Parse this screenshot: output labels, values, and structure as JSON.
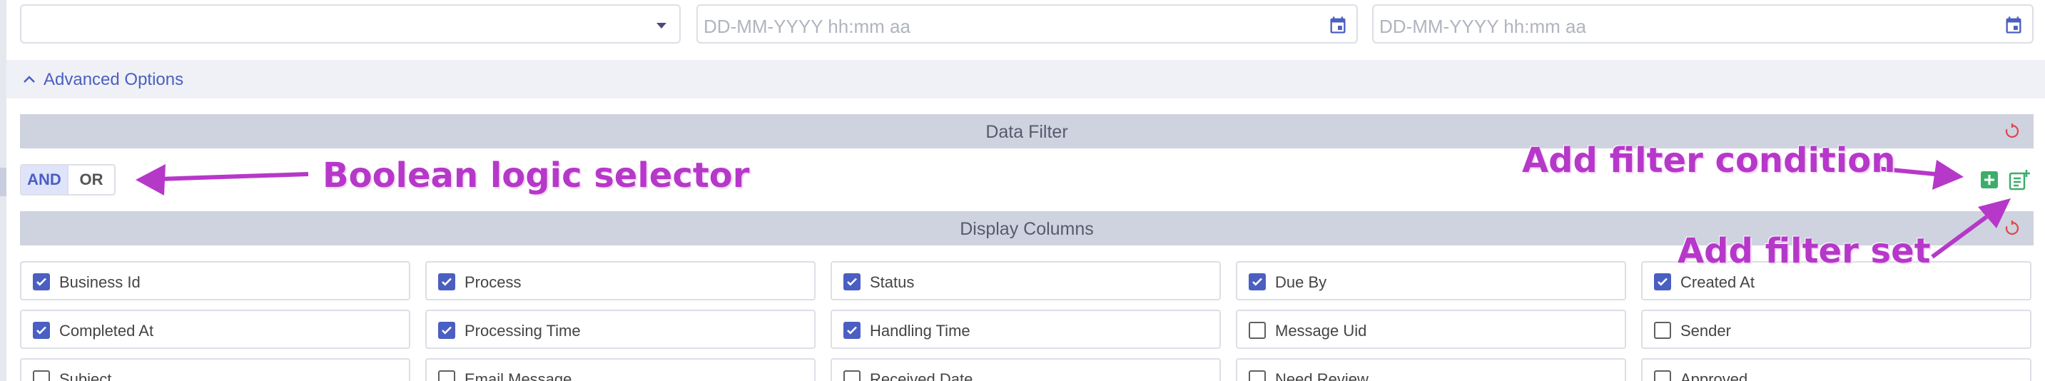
{
  "filters": {
    "select_value": "",
    "date_from_placeholder": "DD-MM-YYYY hh:mm aa",
    "date_to_placeholder": "DD-MM-YYYY hh:mm aa"
  },
  "advanced": {
    "label": "Advanced Options",
    "expanded": true
  },
  "data_filter": {
    "title": "Data Filter",
    "logic_options": [
      "AND",
      "OR"
    ],
    "logic_selected": "AND"
  },
  "display_columns": {
    "title": "Display Columns",
    "items": [
      {
        "label": "Business Id",
        "checked": true
      },
      {
        "label": "Process",
        "checked": true
      },
      {
        "label": "Status",
        "checked": true
      },
      {
        "label": "Due By",
        "checked": true
      },
      {
        "label": "Created At",
        "checked": true
      },
      {
        "label": "Completed At",
        "checked": true
      },
      {
        "label": "Processing Time",
        "checked": true
      },
      {
        "label": "Handling Time",
        "checked": true
      },
      {
        "label": "Message Uid",
        "checked": false
      },
      {
        "label": "Sender",
        "checked": false
      },
      {
        "label": "Subject",
        "checked": false
      },
      {
        "label": "Email Message",
        "checked": false
      },
      {
        "label": "Received Date",
        "checked": false
      },
      {
        "label": "Need Review",
        "checked": false
      },
      {
        "label": "Approved",
        "checked": false
      }
    ]
  },
  "annotations": {
    "logic": "Boolean logic selector",
    "condition": "Add filter condition",
    "set": "Add filter set"
  },
  "colors": {
    "accent": "#4a5fc1",
    "header_band": "#cfd3df",
    "add_icon": "#3cae6a",
    "reset_icon": "#e0454a",
    "annotation": "#b638c9"
  }
}
